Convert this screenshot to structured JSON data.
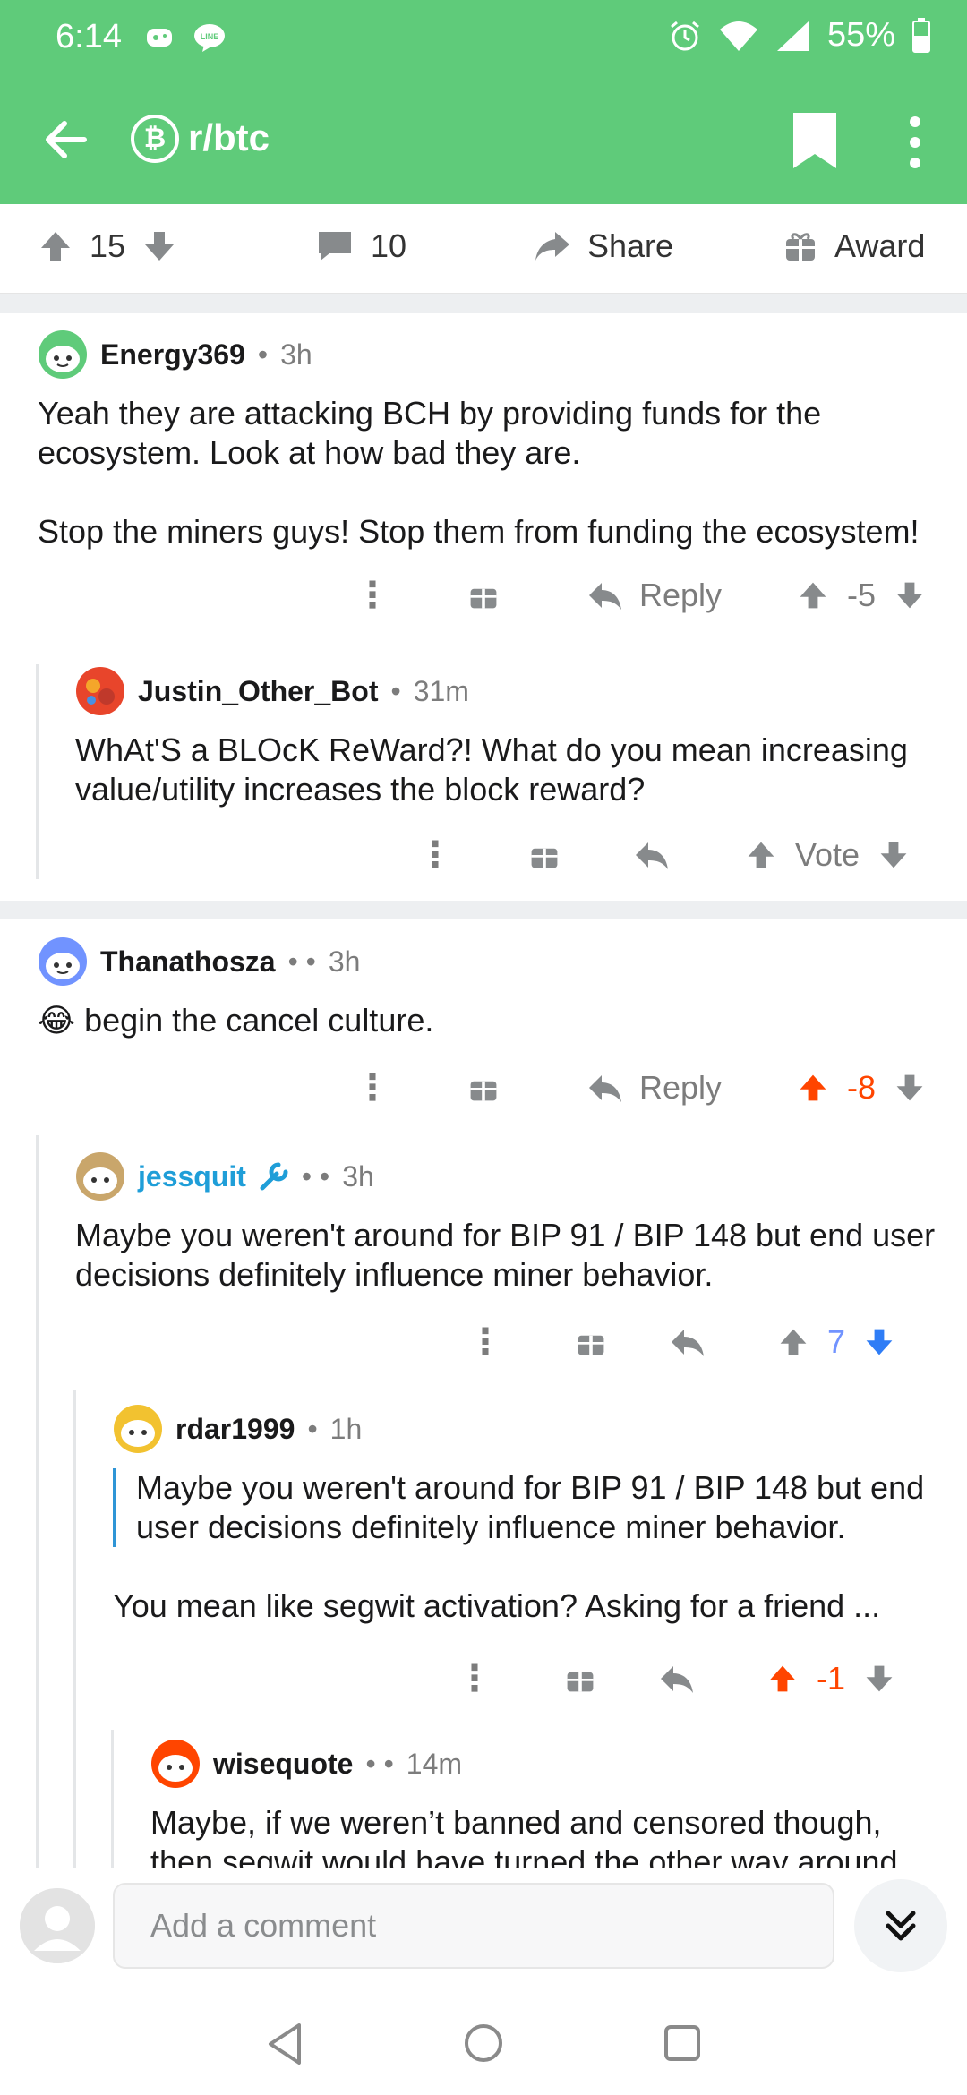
{
  "status_bar": {
    "time": "6:14",
    "battery": "55%"
  },
  "app_bar": {
    "subreddit": "r/btc",
    "subreddit_icon_letter": "₿"
  },
  "post_actions": {
    "upvotes": "15",
    "comments": "10",
    "share": "Share",
    "award": "Award"
  },
  "comments": [
    {
      "author": "Energy369",
      "age": "3h",
      "body": [
        "Yeah they are attacking BCH by providing funds for the ecosystem. Look at how bad they are.",
        "Stop the miners guys! Stop them from funding the ecosystem!"
      ],
      "reply_label": "Reply",
      "score": "-5"
    },
    {
      "author": "Justin_Other_Bot",
      "age": "31m",
      "body": [
        "WhAt'S a BLOcK ReWard?! What do you mean increasing value/utility increases the block reward?"
      ],
      "score": "Vote"
    },
    {
      "author": "Thanathosza",
      "age": "3h",
      "emoji": "😂",
      "body": [
        "begin the cancel culture."
      ],
      "reply_label": "Reply",
      "score": "-8"
    },
    {
      "author": "jessquit",
      "age": "3h",
      "body": [
        "Maybe you weren't around for BIP 91 / BIP 148 but end user decisions definitely influence miner behavior."
      ],
      "score": "7"
    },
    {
      "author": "rdar1999",
      "age": "1h",
      "quote": "Maybe you weren't around for BIP 91 / BIP 148 but end user decisions definitely influence miner behavior.",
      "body": [
        "You mean like segwit activation? Asking for a friend ..."
      ],
      "score": "-1"
    },
    {
      "author": "wisequote",
      "age": "14m",
      "body": [
        "Maybe, if we weren’t banned and censored though, then segwit would have turned the other way around."
      ]
    }
  ],
  "comment_input": {
    "placeholder": "Add a comment"
  },
  "colors": {
    "app_bar": "#5fcb7a",
    "upvoted": "#ff4500",
    "downvoted": "#7193ff",
    "mod_link": "#1f9ed8"
  }
}
